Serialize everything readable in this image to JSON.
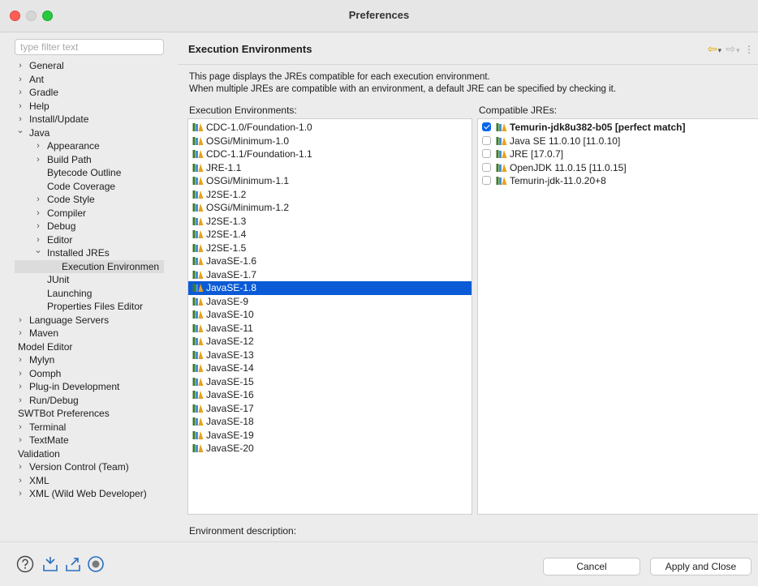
{
  "window": {
    "title": "Preferences"
  },
  "filter": {
    "placeholder": "type filter text"
  },
  "tree": [
    {
      "label": "General",
      "level": 0,
      "chev": "right"
    },
    {
      "label": "Ant",
      "level": 0,
      "chev": "right"
    },
    {
      "label": "Gradle",
      "level": 0,
      "chev": "right"
    },
    {
      "label": "Help",
      "level": 0,
      "chev": "right"
    },
    {
      "label": "Install/Update",
      "level": 0,
      "chev": "right"
    },
    {
      "label": "Java",
      "level": 0,
      "chev": "down"
    },
    {
      "label": "Appearance",
      "level": 1,
      "chev": "right"
    },
    {
      "label": "Build Path",
      "level": 1,
      "chev": "right"
    },
    {
      "label": "Bytecode Outline",
      "level": 1,
      "chev": "none"
    },
    {
      "label": "Code Coverage",
      "level": 1,
      "chev": "none"
    },
    {
      "label": "Code Style",
      "level": 1,
      "chev": "right"
    },
    {
      "label": "Compiler",
      "level": 1,
      "chev": "right"
    },
    {
      "label": "Debug",
      "level": 1,
      "chev": "right"
    },
    {
      "label": "Editor",
      "level": 1,
      "chev": "right"
    },
    {
      "label": "Installed JREs",
      "level": 1,
      "chev": "down"
    },
    {
      "label": "Execution Environmen",
      "level": 2,
      "chev": "none",
      "selected": true
    },
    {
      "label": "JUnit",
      "level": 1,
      "chev": "none"
    },
    {
      "label": "Launching",
      "level": 1,
      "chev": "none"
    },
    {
      "label": "Properties Files Editor",
      "level": 1,
      "chev": "none"
    },
    {
      "label": "Language Servers",
      "level": 0,
      "chev": "right"
    },
    {
      "label": "Maven",
      "level": 0,
      "chev": "right"
    },
    {
      "label": "Model Editor",
      "level": 0,
      "chev": "none"
    },
    {
      "label": "Mylyn",
      "level": 0,
      "chev": "right"
    },
    {
      "label": "Oomph",
      "level": 0,
      "chev": "right"
    },
    {
      "label": "Plug-in Development",
      "level": 0,
      "chev": "right"
    },
    {
      "label": "Run/Debug",
      "level": 0,
      "chev": "right"
    },
    {
      "label": "SWTBot Preferences",
      "level": 0,
      "chev": "none"
    },
    {
      "label": "Terminal",
      "level": 0,
      "chev": "right"
    },
    {
      "label": "TextMate",
      "level": 0,
      "chev": "right"
    },
    {
      "label": "Validation",
      "level": 0,
      "chev": "none"
    },
    {
      "label": "Version Control (Team)",
      "level": 0,
      "chev": "right"
    },
    {
      "label": "XML",
      "level": 0,
      "chev": "right"
    },
    {
      "label": "XML (Wild Web Developer)",
      "level": 0,
      "chev": "right"
    }
  ],
  "page": {
    "title": "Execution Environments",
    "desc_line1": "This page displays the JREs compatible for each execution environment.",
    "desc_line2": "When multiple JREs are compatible with an environment, a default JRE can be specified by checking it.",
    "env_label": "Execution Environments:",
    "jre_label": "Compatible JREs:",
    "env_description_label": "Environment description:"
  },
  "environments": [
    "CDC-1.0/Foundation-1.0",
    "OSGi/Minimum-1.0",
    "CDC-1.1/Foundation-1.1",
    "JRE-1.1",
    "OSGi/Minimum-1.1",
    "J2SE-1.2",
    "OSGi/Minimum-1.2",
    "J2SE-1.3",
    "J2SE-1.4",
    "J2SE-1.5",
    "JavaSE-1.6",
    "JavaSE-1.7",
    "JavaSE-1.8",
    "JavaSE-9",
    "JavaSE-10",
    "JavaSE-11",
    "JavaSE-12",
    "JavaSE-13",
    "JavaSE-14",
    "JavaSE-15",
    "JavaSE-16",
    "JavaSE-17",
    "JavaSE-18",
    "JavaSE-19",
    "JavaSE-20"
  ],
  "selected_environment": "JavaSE-1.8",
  "jres": [
    {
      "label": "Temurin-jdk8u382-b05 [perfect match]",
      "checked": true,
      "bold": true
    },
    {
      "label": "Java SE 11.0.10 [11.0.10]",
      "checked": false
    },
    {
      "label": "JRE [17.0.7]",
      "checked": false
    },
    {
      "label": "OpenJDK 11.0.15 [11.0.15]",
      "checked": false
    },
    {
      "label": "Temurin-jdk-11.0.20+8",
      "checked": false
    }
  ],
  "buttons": {
    "cancel": "Cancel",
    "apply_close": "Apply and Close"
  },
  "colors": {
    "selection": "#0a5bd5",
    "checkbox": "#0a66e6",
    "back_arrow": "#e0a500"
  }
}
